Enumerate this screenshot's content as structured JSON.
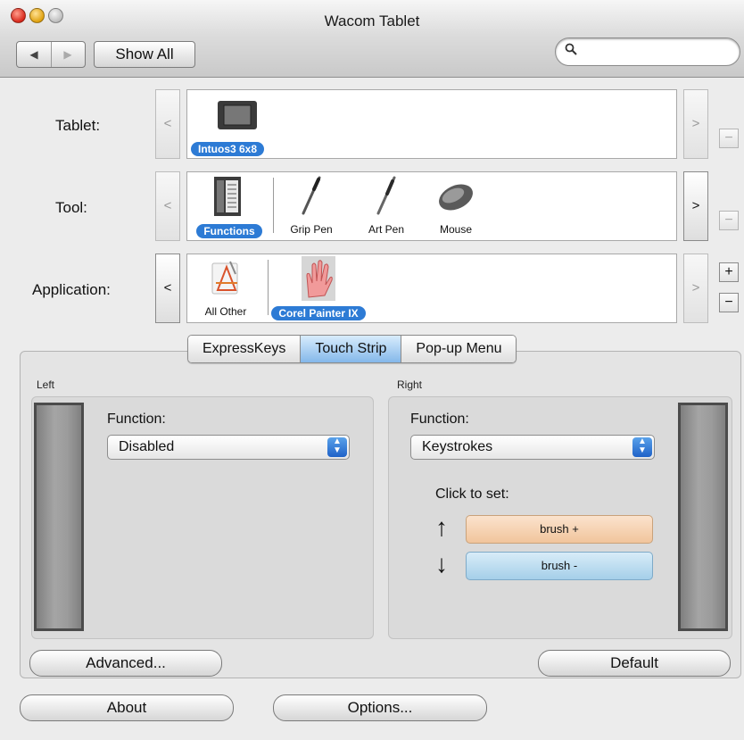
{
  "window": {
    "title": "Wacom Tablet"
  },
  "toolbar": {
    "back": "◀",
    "forward": "▶",
    "show_all": "Show All",
    "search_placeholder": ""
  },
  "rows": {
    "tablet": {
      "label": "Tablet:",
      "left": "<",
      "right": ">",
      "side": "−",
      "items": [
        {
          "name": "Intuos3 6x8",
          "selected": true
        }
      ]
    },
    "tool": {
      "label": "Tool:",
      "left": "<",
      "right": ">",
      "side": "−",
      "items": [
        {
          "name": "Functions",
          "selected": true
        },
        {
          "name": "Grip Pen"
        },
        {
          "name": "Art Pen"
        },
        {
          "name": "Mouse"
        }
      ]
    },
    "application": {
      "label": "Application:",
      "left": "<",
      "right": ">",
      "plus": "+",
      "minus": "−",
      "items": [
        {
          "name": "All Other"
        },
        {
          "name": "Corel Painter IX",
          "selected": true
        }
      ]
    }
  },
  "tabs": [
    {
      "label": "ExpressKeys"
    },
    {
      "label": "Touch Strip",
      "selected": true
    },
    {
      "label": "Pop-up Menu"
    }
  ],
  "left_group": {
    "title": "Left",
    "function_label": "Function:",
    "function_value": "Disabled"
  },
  "right_group": {
    "title": "Right",
    "function_label": "Function:",
    "function_value": "Keystrokes",
    "click_to_set": "Click to set:",
    "up_arrow": "↑",
    "down_arrow": "↓",
    "up_key": "brush +",
    "down_key": "brush -"
  },
  "buttons": {
    "advanced": "Advanced...",
    "default": "Default",
    "about": "About",
    "options": "Options..."
  },
  "colors": {
    "selection_blue": "#2d7bd5",
    "up_key": "#f1c59c",
    "down_key": "#a5cfe9"
  },
  "icons": [
    "search-icon",
    "tablet-icon",
    "functions-icon",
    "grip-pen-icon",
    "art-pen-icon",
    "mouse-icon",
    "all-other-apps-icon",
    "corel-painter-icon"
  ]
}
